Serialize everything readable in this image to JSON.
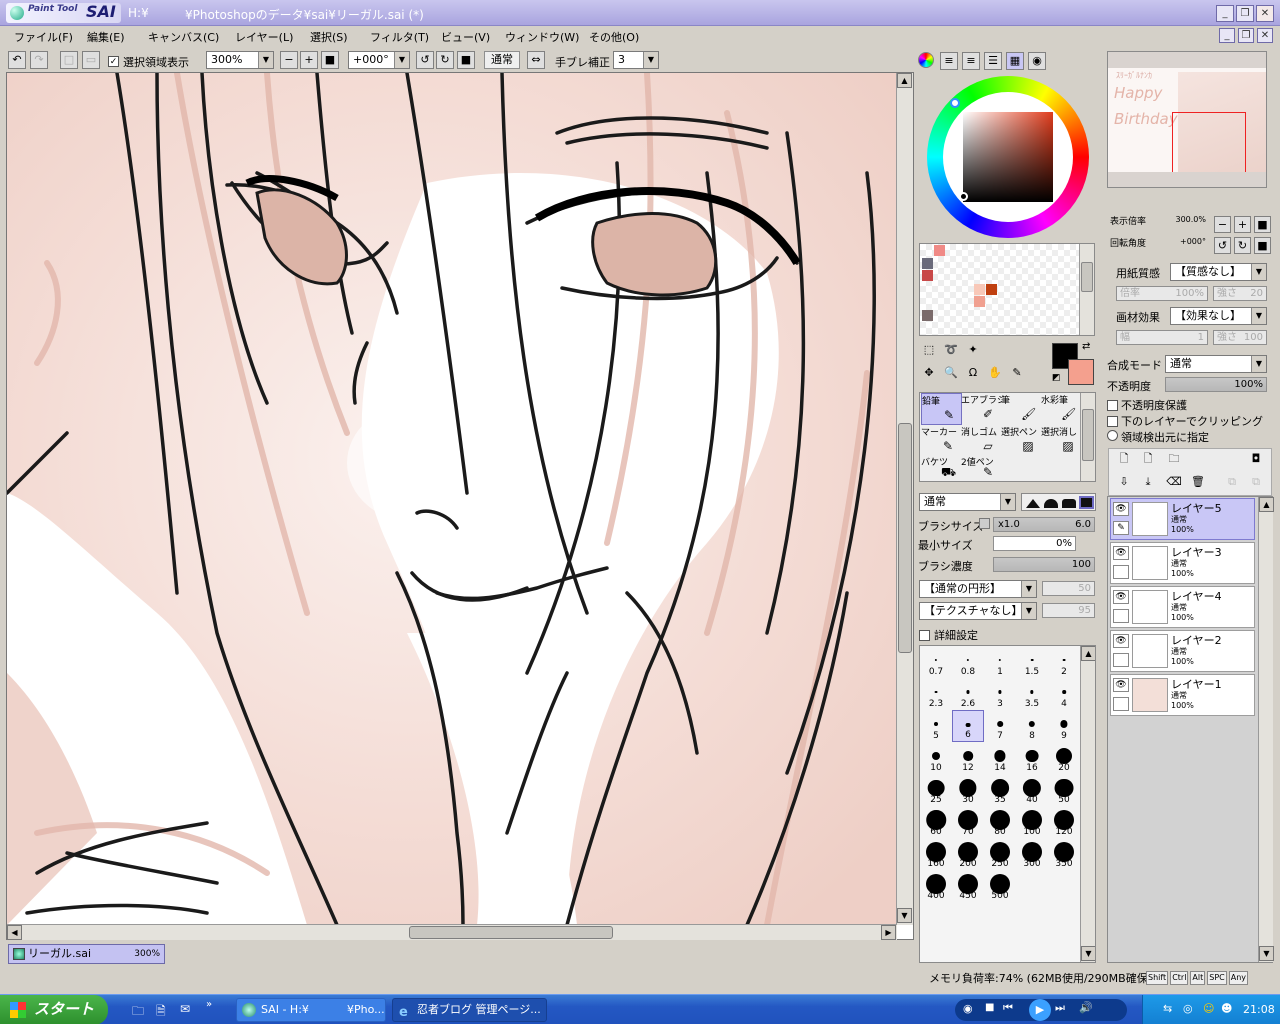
{
  "window": {
    "logo_small": "Paint Tool",
    "logo_big": "SAI",
    "title_left": "H:¥",
    "title": "¥Photoshopのデータ¥sai¥リーガル.sai (*)"
  },
  "menu": [
    "ファイル(F)",
    "編集(E)",
    "キャンバス(C)",
    "レイヤー(L)",
    "選択(S)",
    "フィルタ(T)",
    "ビュー(V)",
    "ウィンドウ(W)",
    "その他(O)"
  ],
  "toolbar": {
    "show_selection_label": "選択領域表示",
    "zoom_value": "300%",
    "rotation_value": "+000°",
    "blend_label": "通常",
    "stabilizer_label": "手ブレ補正",
    "stabilizer_value": "3"
  },
  "document_tab": {
    "name": "リーガル.sai",
    "zoom": "300%"
  },
  "navigator": {
    "zoom_label": "表示倍率",
    "zoom_value": "300.0%",
    "rotation_label": "回転角度",
    "rotation_value": "+000°",
    "preview_text": [
      "ｽﾘｰｶﾞﾙﾅﾝｶ",
      "Happy",
      "Birthday"
    ]
  },
  "paper": {
    "texture_label": "用紙質感",
    "texture_value": "【質感なし】",
    "scale_label": "倍率",
    "scale_value": "100%",
    "strength_label": "強さ",
    "strength_value": "20",
    "effect_label": "画材効果",
    "effect_value": "【効果なし】",
    "width_label": "幅",
    "width_value": "1",
    "effect_strength_label": "強さ",
    "effect_strength_value": "100"
  },
  "layer_props": {
    "blend_mode_label": "合成モード",
    "blend_mode_value": "通常",
    "opacity_label": "不透明度",
    "opacity_value": "100%",
    "opacity_level": 1.0,
    "preserve_opacity": "不透明度保護",
    "clipping": "下のレイヤーでクリッピング",
    "selection_source": "領域検出元に指定"
  },
  "layers": [
    {
      "name": "レイヤー5",
      "mode": "通常",
      "opacity": "100%",
      "selected": true
    },
    {
      "name": "レイヤー3",
      "mode": "通常",
      "opacity": "100%",
      "selected": false
    },
    {
      "name": "レイヤー4",
      "mode": "通常",
      "opacity": "100%",
      "selected": false
    },
    {
      "name": "レイヤー2",
      "mode": "通常",
      "opacity": "100%",
      "selected": false
    },
    {
      "name": "レイヤー1",
      "mode": "通常",
      "opacity": "100%",
      "selected": false
    }
  ],
  "tools": [
    {
      "label": "鉛筆",
      "icon": "pencil-icon",
      "selected": true
    },
    {
      "label": "エアブラシ",
      "icon": "airbrush-icon",
      "selected": false
    },
    {
      "label": "筆",
      "icon": "brush-icon",
      "selected": false
    },
    {
      "label": "水彩筆",
      "icon": "watercolor-icon",
      "selected": false
    },
    {
      "label": "マーカー",
      "icon": "marker-icon",
      "selected": false
    },
    {
      "label": "消しゴム",
      "icon": "eraser-icon",
      "selected": false
    },
    {
      "label": "選択ペン",
      "icon": "select-pen-icon",
      "selected": false
    },
    {
      "label": "選択消し",
      "icon": "select-eraser-icon",
      "selected": false
    },
    {
      "label": "バケツ",
      "icon": "bucket-icon",
      "selected": false
    },
    {
      "label": "2値ペン",
      "icon": "binary-pen-icon",
      "selected": false
    }
  ],
  "brush": {
    "blend_value": "通常",
    "size_label": "ブラシサイズ",
    "size_mult": "x1.0",
    "size_value": "6.0",
    "min_size_label": "最小サイズ",
    "min_size_value": "0%",
    "density_label": "ブラシ濃度",
    "density_value": "100",
    "shape_value": "【通常の円形】",
    "shape_strength": "50",
    "texture_value": "【テクスチャなし】",
    "texture_strength": "95",
    "advanced_label": "詳細設定"
  },
  "brush_sizes": [
    "0.7",
    "0.8",
    "1",
    "1.5",
    "2",
    "2.3",
    "2.6",
    "3",
    "3.5",
    "4",
    "5",
    "6",
    "7",
    "8",
    "9",
    "10",
    "12",
    "14",
    "16",
    "20",
    "25",
    "30",
    "35",
    "40",
    "50",
    "60",
    "70",
    "80",
    "100",
    "120",
    "160",
    "200",
    "250",
    "300",
    "350",
    "400",
    "450",
    "500"
  ],
  "selected_brush_size": "6",
  "colors": {
    "foreground": "#000000",
    "background": "#f4a08e",
    "swatches": [
      "#f08a86",
      "#6a6a7a",
      "#c84848",
      "#f8c8b8",
      "#c04010",
      "#f0a090",
      "#7a6a6a"
    ]
  },
  "status": {
    "memory": "メモリ負荷率:74% (62MB使用/290MB確保)",
    "keys": [
      "Shift",
      "Ctrl",
      "Alt",
      "SPC",
      "Any"
    ]
  },
  "taskbar": {
    "start_label": "スタート",
    "tasks": [
      "SAI - H:¥",
      "¥Pho...",
      "忍者ブログ 管理ページ..."
    ],
    "clock": "21:08"
  }
}
